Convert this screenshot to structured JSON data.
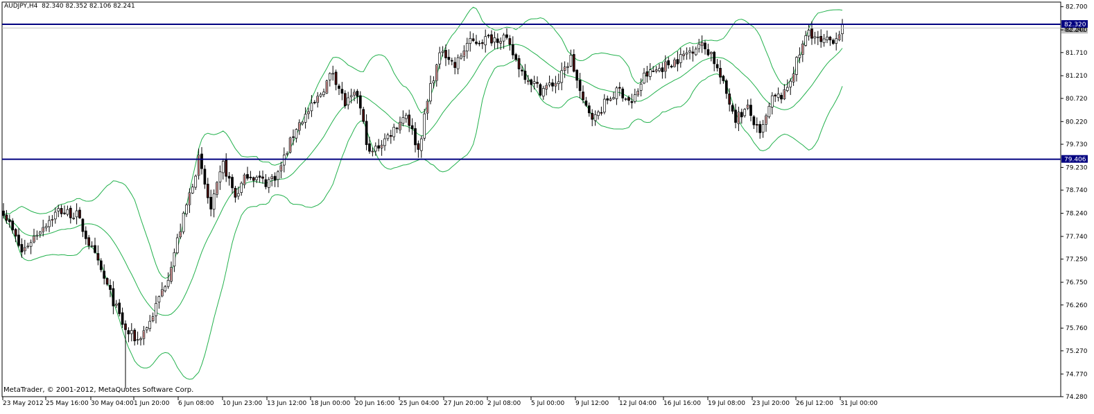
{
  "header": {
    "symbol": "AUDJPY,H4",
    "ohlc": "82.340 82.352 82.106 82.241"
  },
  "copyright": "MetaTrader, © 2001-2012, MetaQuotes Software Corp.",
  "colors": {
    "background": "#ffffff",
    "frame": "#000000",
    "band": "#22b14c",
    "bull_body": "#ffffff",
    "bear_body": "#000000",
    "marker": "#8b1a1a",
    "level_line": "#000080",
    "bid_line": "#c0c0c0"
  },
  "chart_data": {
    "type": "candlestick",
    "symbol": "AUDJPY",
    "timeframe": "H4",
    "ylim": [
      74.28,
      82.8
    ],
    "y_ticks": [
      "82.700",
      "82.200",
      "81.710",
      "81.210",
      "80.720",
      "80.220",
      "79.730",
      "79.230",
      "78.740",
      "78.240",
      "77.740",
      "77.250",
      "76.750",
      "76.260",
      "75.760",
      "75.270",
      "74.770",
      "74.280"
    ],
    "x_ticks": [
      "23 May 2012",
      "25 May 16:00",
      "30 May 04:00",
      "1 Jun 20:00",
      "6 Jun 08:00",
      "10 Jun 23:00",
      "13 Jun 12:00",
      "18 Jun 00:00",
      "20 Jun 16:00",
      "25 Jun 04:00",
      "27 Jun 20:00",
      "2 Jul 08:00",
      "5 Jul 00:00",
      "9 Jul 12:00",
      "12 Jul 04:00",
      "16 Jul 16:00",
      "19 Jul 08:00",
      "23 Jul 20:00",
      "26 Jul 12:00",
      "31 Jul 00:00"
    ],
    "horizontal_levels": [
      {
        "label": "82.320",
        "value": 82.32
      },
      {
        "label": "79.406",
        "value": 79.406
      }
    ],
    "bid": {
      "label": "82.241",
      "value": 82.241
    },
    "indicator": "Bollinger Bands",
    "close_path": [
      [
        0,
        78.3
      ],
      [
        6,
        77.4
      ],
      [
        12,
        77.9
      ],
      [
        18,
        78.3
      ],
      [
        24,
        78.2
      ],
      [
        30,
        77.3
      ],
      [
        35,
        76.5
      ],
      [
        40,
        75.7
      ],
      [
        44,
        75.5
      ],
      [
        48,
        75.9
      ],
      [
        54,
        76.9
      ],
      [
        60,
        78.4
      ],
      [
        64,
        79.4
      ],
      [
        68,
        78.3
      ],
      [
        72,
        79.3
      ],
      [
        76,
        78.6
      ],
      [
        80,
        79.1
      ],
      [
        86,
        78.9
      ],
      [
        90,
        79.1
      ],
      [
        96,
        80.1
      ],
      [
        102,
        80.6
      ],
      [
        108,
        81.3
      ],
      [
        112,
        80.6
      ],
      [
        116,
        80.8
      ],
      [
        120,
        79.5
      ],
      [
        126,
        79.9
      ],
      [
        132,
        80.4
      ],
      [
        136,
        79.6
      ],
      [
        140,
        81.0
      ],
      [
        144,
        81.8
      ],
      [
        148,
        81.4
      ],
      [
        152,
        81.9
      ],
      [
        158,
        82.0
      ],
      [
        164,
        82.05
      ],
      [
        170,
        81.3
      ],
      [
        176,
        80.9
      ],
      [
        182,
        81.1
      ],
      [
        186,
        81.6
      ],
      [
        190,
        80.6
      ],
      [
        194,
        80.3
      ],
      [
        198,
        80.7
      ],
      [
        202,
        80.9
      ],
      [
        206,
        80.6
      ],
      [
        210,
        81.2
      ],
      [
        216,
        81.4
      ],
      [
        222,
        81.6
      ],
      [
        228,
        81.9
      ],
      [
        232,
        81.7
      ],
      [
        236,
        81.0
      ],
      [
        240,
        80.3
      ],
      [
        244,
        80.5
      ],
      [
        248,
        79.9
      ],
      [
        252,
        80.7
      ],
      [
        256,
        80.8
      ],
      [
        260,
        81.5
      ],
      [
        264,
        82.2
      ],
      [
        268,
        81.9
      ],
      [
        272,
        82.0
      ],
      [
        275,
        82.24
      ]
    ]
  }
}
